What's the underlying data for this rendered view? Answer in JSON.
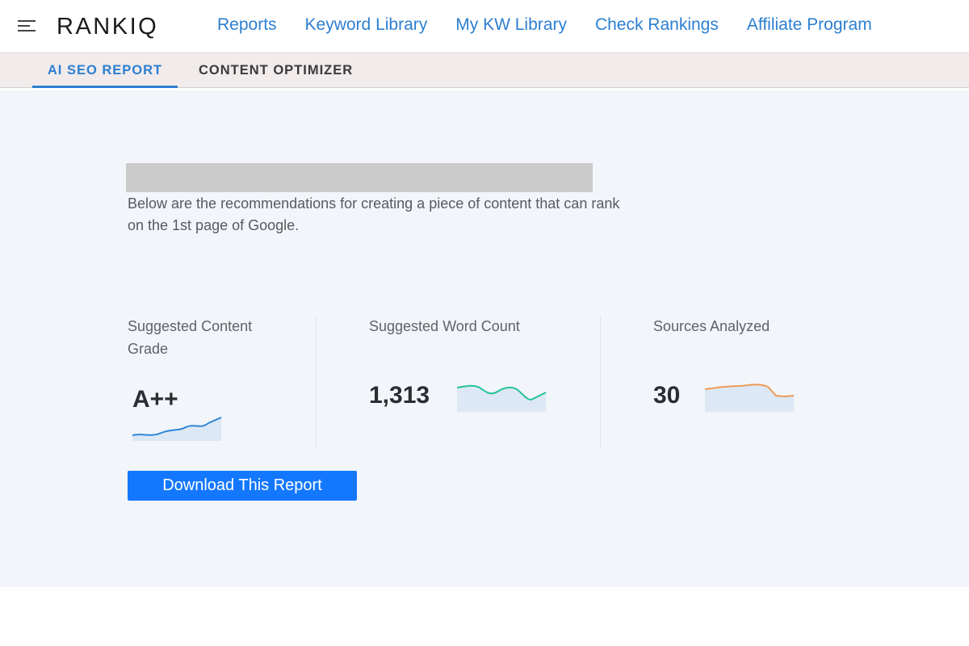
{
  "header": {
    "logo_text": "RANKIQ",
    "nav": [
      {
        "label": "Reports"
      },
      {
        "label": "Keyword Library"
      },
      {
        "label": "My KW Library"
      },
      {
        "label": "Check Rankings"
      },
      {
        "label": "Affiliate Program"
      }
    ],
    "icons": {
      "menu": "hamburger-menu-icon",
      "logo": "rankiq-logo-icon"
    }
  },
  "tabs": {
    "active_label": "AI SEO REPORT",
    "inactive_label": "CONTENT OPTIMIZER"
  },
  "report": {
    "intro_text": "Below are the recommendations for creating a piece of content that can rank on the 1st page of Google.",
    "metrics": [
      {
        "label": "Suggested Content Grade",
        "value": "A++"
      },
      {
        "label": "Suggested Word Count",
        "value": "1,313"
      },
      {
        "label": "Sources Analyzed",
        "value": "30"
      }
    ],
    "download_label": "Download This Report"
  },
  "colors": {
    "nav_link": "#2d7fd1",
    "download_button": "#1478ff",
    "sparkline_grade": "#2f86d6",
    "sparkline_wordcount": "#22c39a",
    "sparkline_sources": "#ee9a55",
    "background": "#f2f5f9"
  }
}
